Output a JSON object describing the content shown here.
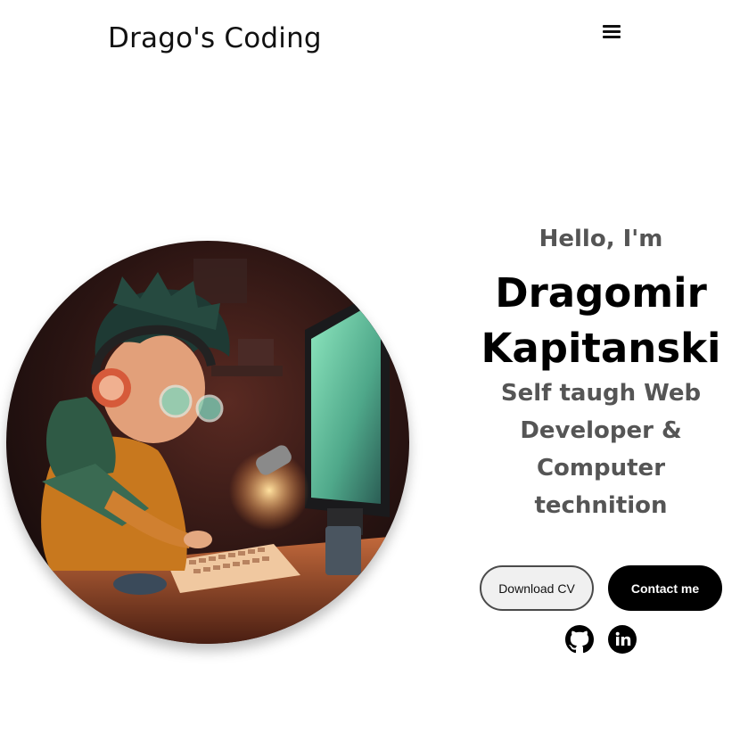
{
  "header": {
    "logo_text": "Drago's Coding",
    "menu_icon": "hamburger-menu-icon"
  },
  "hero": {
    "greeting": "Hello, I'm",
    "name_line1": "Dragomir",
    "name_line2": "Kapitanski",
    "tagline_lines": [
      "Self taugh Web",
      "Developer &",
      "Computer",
      "technition"
    ],
    "profile_image_alt": "Profile picture"
  },
  "buttons": {
    "download_cv": "Download CV",
    "contact_me": "Contact me"
  },
  "socials": [
    {
      "icon": "github-icon"
    },
    {
      "icon": "linkedin-icon"
    }
  ],
  "colors": {
    "text_primary": "#000000",
    "text_secondary": "#555555",
    "button_dark": "#000000",
    "button_light": "#f0f0f0"
  }
}
